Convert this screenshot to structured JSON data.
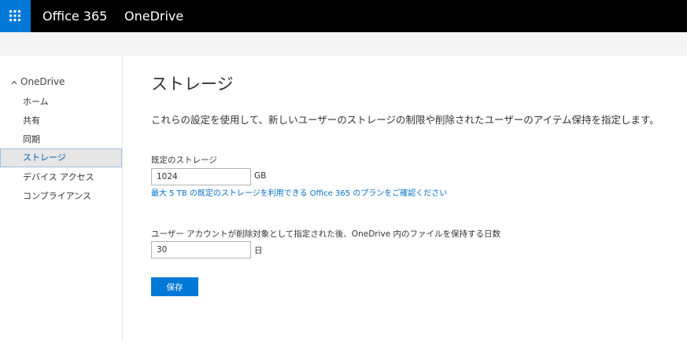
{
  "header": {
    "brand": "Office 365",
    "app_name": "OneDrive",
    "app_launcher_icon": "waffle-icon"
  },
  "sidebar": {
    "header": "OneDrive",
    "header_icon": "chevron-up-icon",
    "items": [
      {
        "label": "ホーム"
      },
      {
        "label": "共有"
      },
      {
        "label": "同期"
      },
      {
        "label": "ストレージ",
        "selected": true
      },
      {
        "label": "デバイス アクセス"
      },
      {
        "label": "コンプライアンス"
      }
    ]
  },
  "main": {
    "title": "ストレージ",
    "description": "これらの設定を使用して、新しいユーザーのストレージの制限や削除されたユーザーのアイテム保持を指定します。",
    "default_storage": {
      "label": "既定のストレージ",
      "value": "1024",
      "unit": "GB",
      "link": "最大 5 TB の既定のストレージを利用できる Office 365 のプランをご確認ください"
    },
    "retention": {
      "label": "ユーザー アカウントが削除対象として指定された後、OneDrive 内のファイルを保持する日数",
      "value": "30",
      "unit": "日"
    },
    "save_label": "保存"
  },
  "colors": {
    "accent": "#0078d7",
    "topbar": "#000000",
    "link": "#0072c6"
  }
}
